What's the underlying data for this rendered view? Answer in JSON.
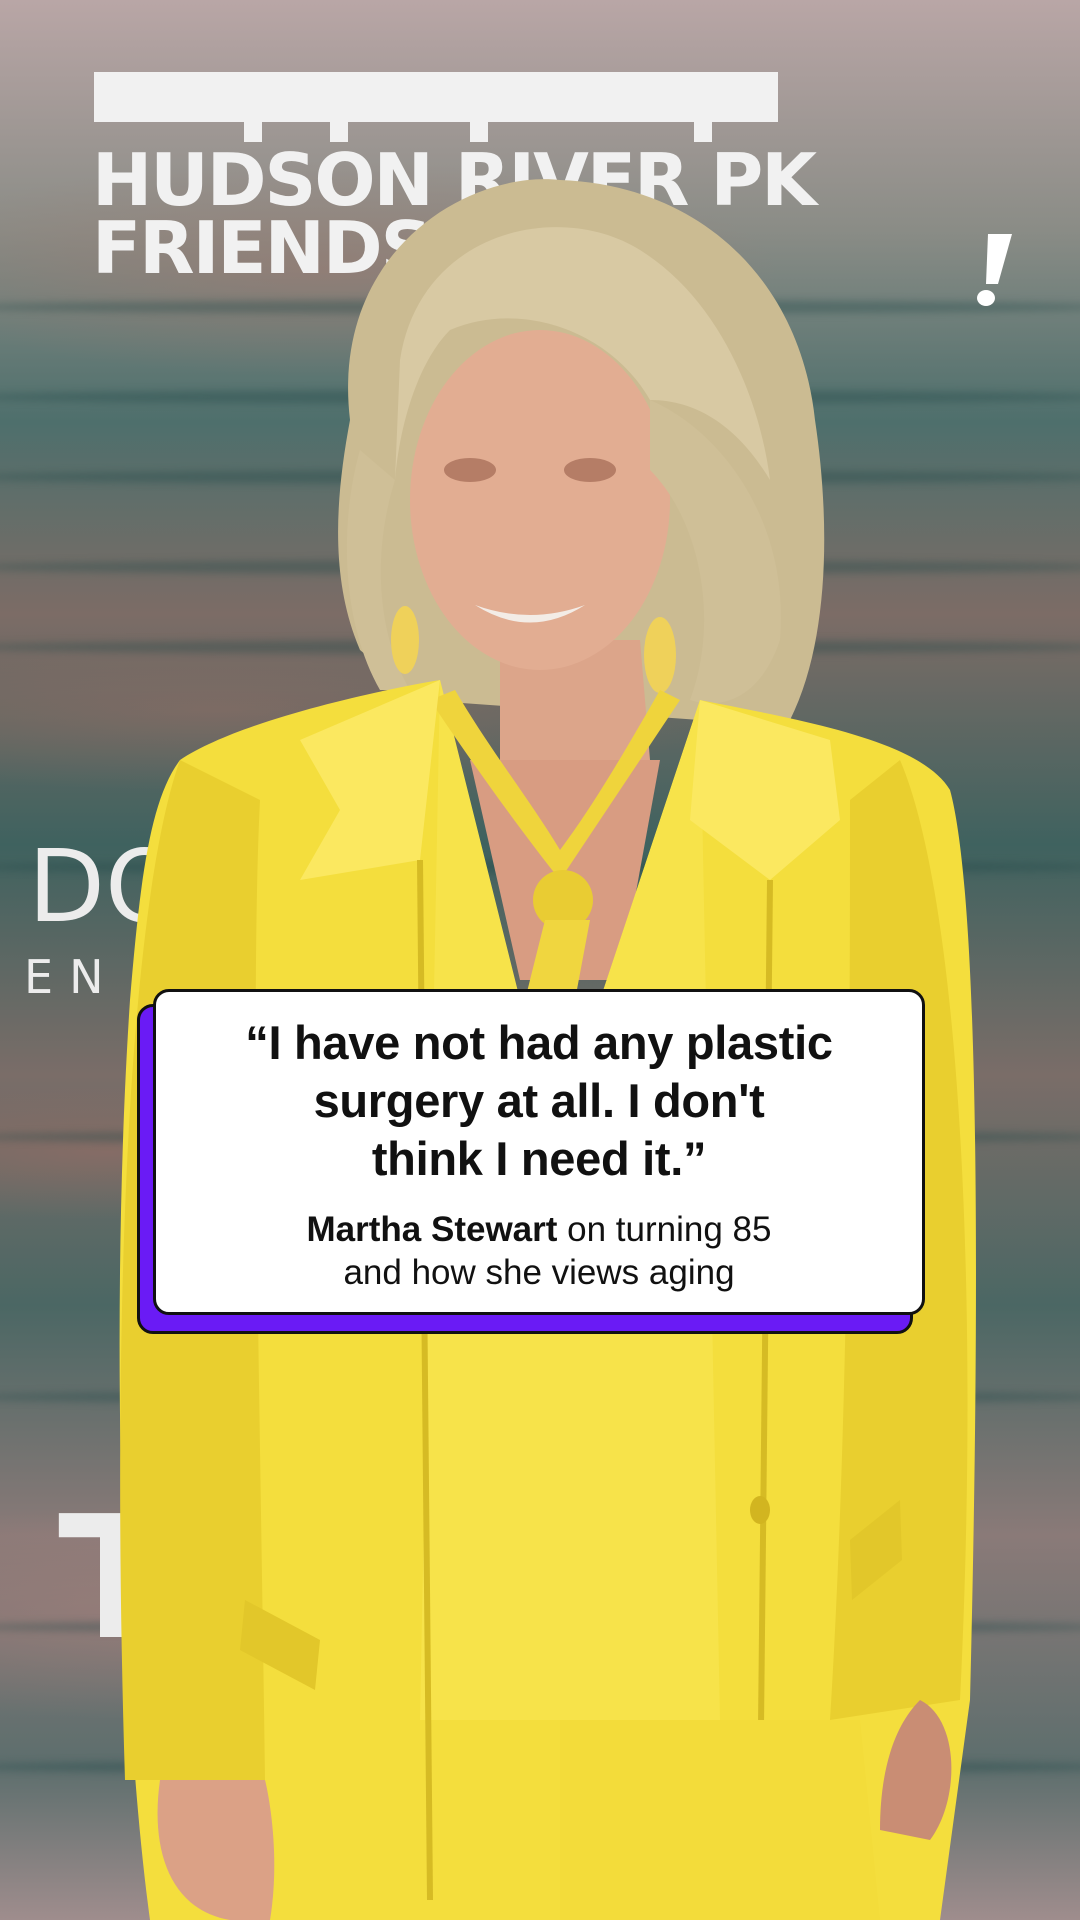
{
  "backdrop": {
    "logo_line_1": "HUDSON RIVER PK",
    "logo_line_2": "FRIENDS",
    "fragment_left_top": "DO",
    "fragment_left_bottom": "EN",
    "fragment_left_lower": "T"
  },
  "brand_mark": "exclamation-icon",
  "quote_card": {
    "quote_line_1": "“I have not had any plastic",
    "quote_line_2": "surgery at all. I don't",
    "quote_line_3": "think I need it.”",
    "attribution_name": "Martha Stewart",
    "attribution_rest_1": " on turning 85",
    "attribution_line_2": "and how she views aging",
    "accent_color": "#6a1bf5",
    "card_color": "#ffffff"
  }
}
